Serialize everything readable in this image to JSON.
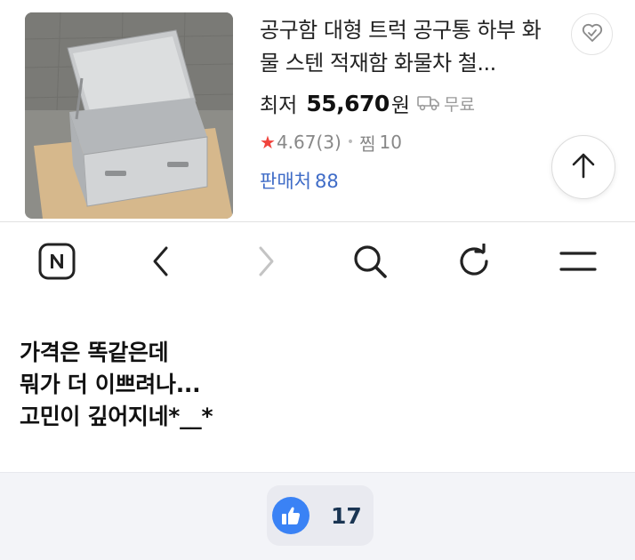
{
  "product": {
    "title": "공구함 대형 트럭 공구통 하부 화물 스텐 적재함 화물차 철...",
    "price_label": "최저",
    "price_value": "55,670",
    "price_unit": "원",
    "shipping_label": "무료",
    "rating": "4.67",
    "rating_count": "(3)",
    "wish_label": "찜",
    "wish_count": "10",
    "seller_label": "판매처",
    "seller_count": "88",
    "icons": {
      "favorite": "heart-check-icon",
      "shipping": "truck-icon",
      "star": "star-icon",
      "scroll_top": "arrow-up-icon"
    },
    "colors": {
      "star": "#f0433c",
      "seller": "#3f6cc7"
    }
  },
  "toolbar": {
    "items": [
      {
        "icon": "naver-home-icon"
      },
      {
        "icon": "back-arrow-icon",
        "enabled": true
      },
      {
        "icon": "forward-arrow-icon",
        "enabled": false
      },
      {
        "icon": "search-icon"
      },
      {
        "icon": "refresh-icon"
      },
      {
        "icon": "menu-icon"
      }
    ]
  },
  "post": {
    "lines": [
      "가격은 똑같은데",
      "뭐가 더 이쁘려나...",
      "고민이 깊어지네*__*"
    ]
  },
  "like": {
    "icon": "thumbs-up-icon",
    "count": "17",
    "color": "#3a82f5"
  }
}
